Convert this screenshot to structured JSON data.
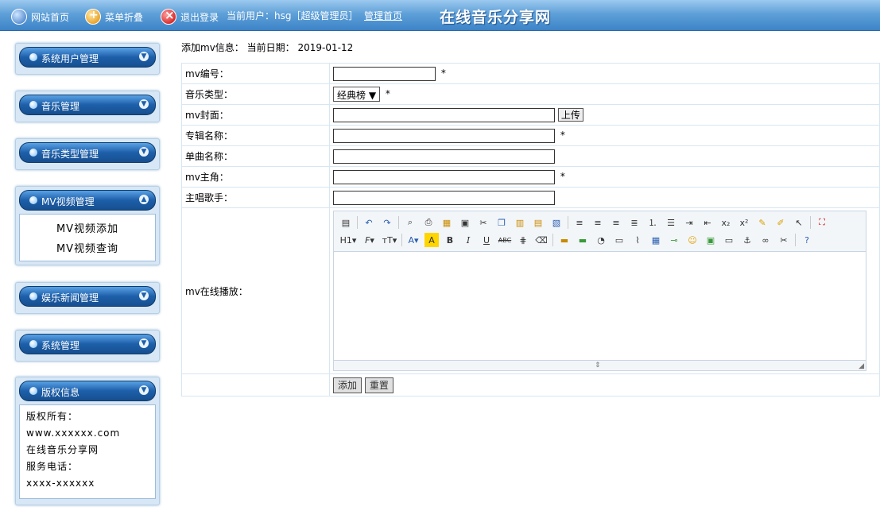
{
  "topbar": {
    "home_label": "网站首页",
    "fold_label": "菜单折叠",
    "logout_label": "退出登录",
    "current_user_label": "当前用户：hsg［超级管理员］",
    "admin_home_label": "管理首页",
    "site_title": "在线音乐分享网"
  },
  "sidebar": {
    "menus": [
      {
        "label": "系统用户管理"
      },
      {
        "label": "音乐管理"
      },
      {
        "label": "音乐类型管理"
      },
      {
        "label": "MV视频管理",
        "items": [
          "MV视频添加",
          "MV视频查询"
        ]
      },
      {
        "label": "娱乐新闻管理"
      },
      {
        "label": "系统管理"
      },
      {
        "label": "版权信息"
      }
    ],
    "copyright": {
      "line1": "版权所有：",
      "line2": "www.xxxxxx.com",
      "line3": "在线音乐分享网",
      "line4": "服务电话：",
      "line5": "xxxx-xxxxxx"
    }
  },
  "main": {
    "info_label": "添加mv信息：",
    "date_label": "当前日期：",
    "date_value": "2019-01-12",
    "fields": {
      "mv_id": "mv编号：",
      "music_type": "音乐类型：",
      "music_type_value": "经典榜",
      "mv_cover": "mv封面：",
      "upload_button": "上传",
      "album_name": "专辑名称：",
      "single_name": "单曲名称：",
      "mv_lead": "mv主角：",
      "lead_singer": "主唱歌手：",
      "mv_online": "mv在线播放：",
      "required_mark": "*"
    },
    "buttons": {
      "add": "添加",
      "reset": "重置"
    }
  }
}
